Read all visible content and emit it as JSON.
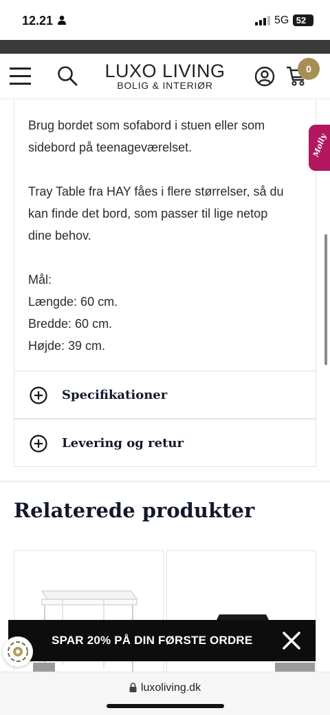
{
  "status_bar": {
    "time": "12.21",
    "network": "5G",
    "battery": "52"
  },
  "header": {
    "logo_main": "LUXO LIVING",
    "logo_sub": "BOLIG & INTERIØR",
    "cart_count": "0"
  },
  "description": {
    "paragraphs": [
      "Brug bordet som sofabord i stuen eller som",
      "sidebord på teenageværelset.",
      "Tray Table fra HAY fåes i flere størrelser, så du",
      "kan finde det bord, som passer til lige netop",
      "dine behov.",
      "Mål:",
      "Længde: 60 cm.",
      "Bredde: 60 cm.",
      "Højde: 39 cm."
    ]
  },
  "accordion": [
    {
      "label": "Specifikationer"
    },
    {
      "label": "Levering og retur"
    }
  ],
  "related": {
    "heading": "Relaterede produkter"
  },
  "promo": {
    "text": "SPAR 20% PÅ DIN FØRSTE ORDRE"
  },
  "chat_widget": {
    "label": "Molly"
  },
  "browser": {
    "url": "luxoliving.dk"
  },
  "colors": {
    "accent": "#a58f55",
    "heading": "#14182e",
    "promo_bg": "#0d0d0d",
    "chat_tab": "#b3175f"
  }
}
